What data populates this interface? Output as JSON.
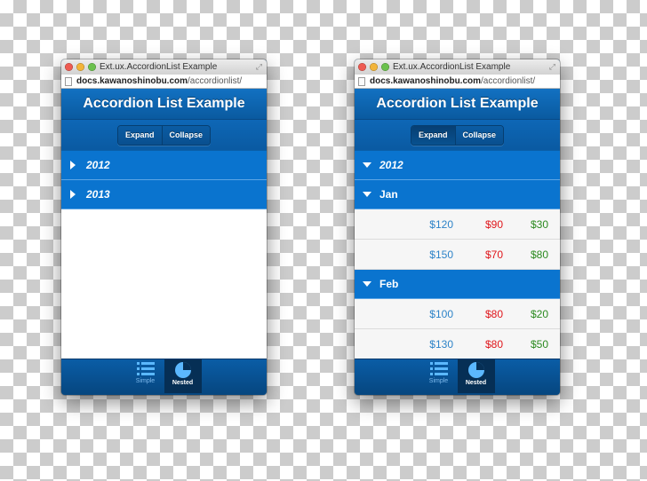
{
  "windows": [
    {
      "id": "left",
      "window_title": "Ext.ux.AccordionList Example",
      "url_domain": "docs.kawanoshinobu.com",
      "url_path": "/accordionlist/",
      "app_title": "Accordion List Example",
      "toolbar": {
        "expand_label": "Expand",
        "collapse_label": "Collapse",
        "pressed": "none"
      },
      "rows": [
        {
          "type": "header",
          "label": "2012",
          "expanded": false,
          "italic": true
        },
        {
          "type": "header",
          "label": "2013",
          "expanded": false,
          "italic": true
        }
      ],
      "tabs": [
        {
          "label": "Simple",
          "icon": "list-icon",
          "active": false
        },
        {
          "label": "Nested",
          "icon": "pie-chart-icon",
          "active": true
        }
      ]
    },
    {
      "id": "right",
      "window_title": "Ext.ux.AccordionList Example",
      "url_domain": "docs.kawanoshinobu.com",
      "url_path": "/accordionlist/",
      "app_title": "Accordion List Example",
      "toolbar": {
        "expand_label": "Expand",
        "collapse_label": "Collapse",
        "pressed": "expand"
      },
      "rows": [
        {
          "type": "header",
          "label": "2012",
          "expanded": true,
          "italic": true
        },
        {
          "type": "header",
          "label": "Jan",
          "expanded": true,
          "italic": false
        },
        {
          "type": "data",
          "values": [
            "$120",
            "$90",
            "$30"
          ]
        },
        {
          "type": "data",
          "values": [
            "$150",
            "$70",
            "$80"
          ]
        },
        {
          "type": "header",
          "label": "Feb",
          "expanded": true,
          "italic": false
        },
        {
          "type": "data",
          "values": [
            "$100",
            "$80",
            "$20"
          ]
        },
        {
          "type": "data",
          "values": [
            "$130",
            "$80",
            "$50"
          ]
        }
      ],
      "tabs": [
        {
          "label": "Simple",
          "icon": "list-icon",
          "active": false
        },
        {
          "label": "Nested",
          "icon": "pie-chart-icon",
          "active": true
        }
      ]
    }
  ],
  "colors": {
    "header_blue": "#0a74cf",
    "value_blue": "#2d83c8",
    "value_red": "#e0161b",
    "value_green": "#2b8a1f"
  }
}
